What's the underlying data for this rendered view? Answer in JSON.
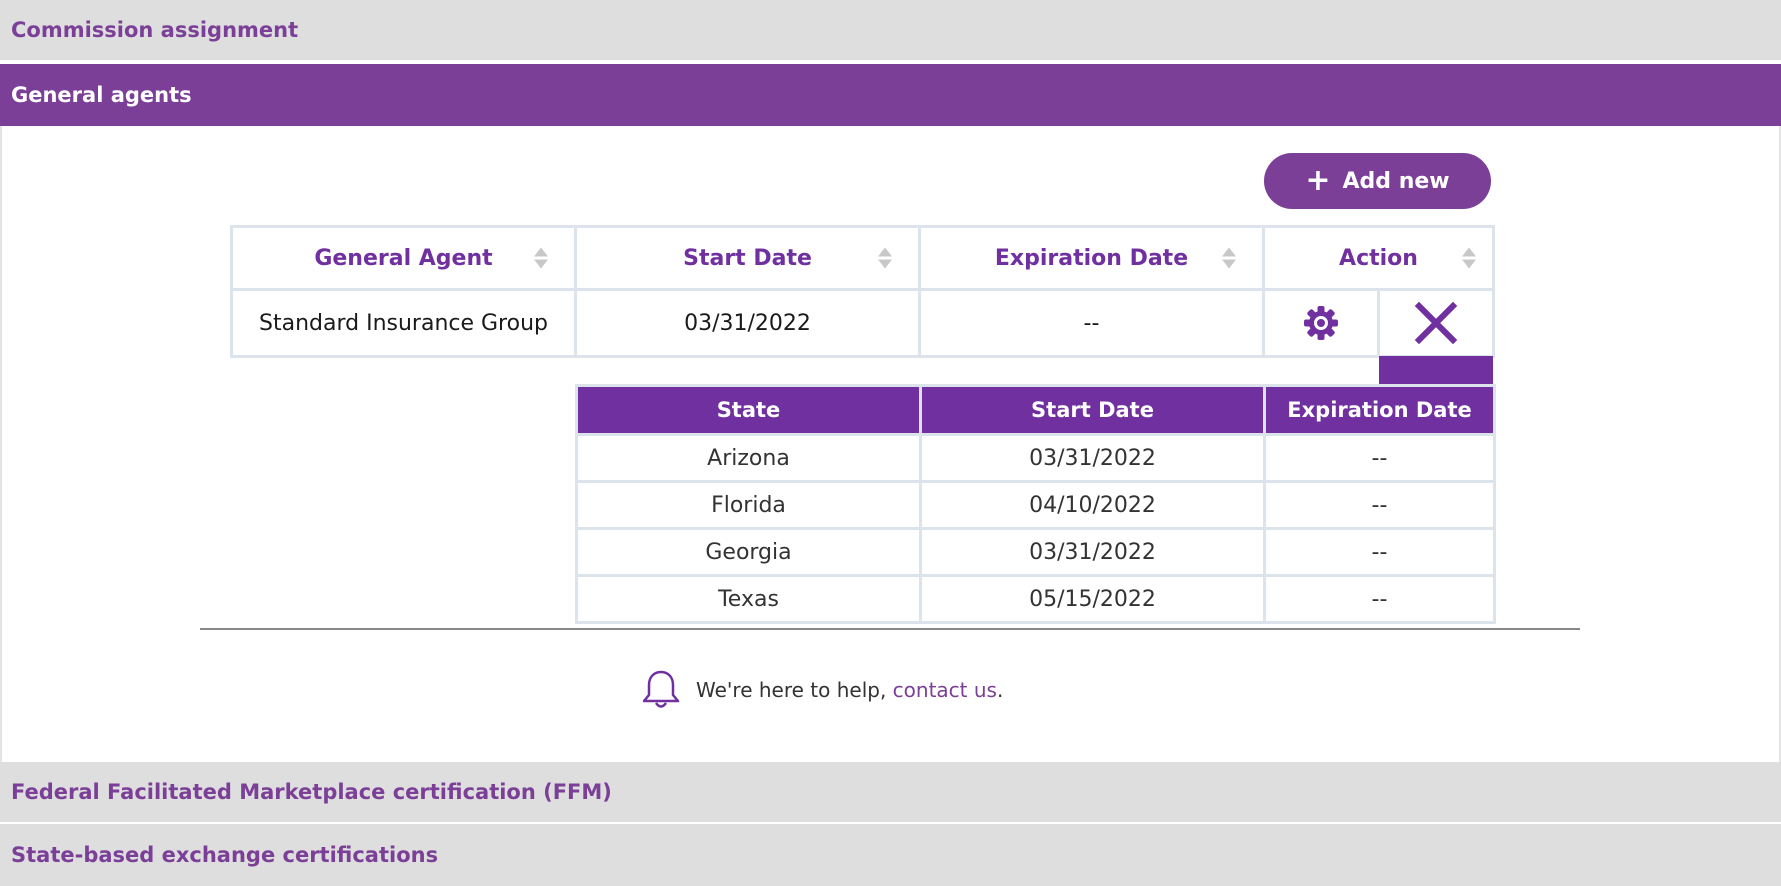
{
  "sections": {
    "commission": "Commission assignment",
    "general_agents": "General agents",
    "ffm": "Federal Facilitated Marketplace certification (FFM)",
    "sbe": "State-based exchange certifications"
  },
  "add_button": {
    "label": "Add new",
    "icon": "plus-icon"
  },
  "agent_table": {
    "columns": [
      "General Agent",
      "Start Date",
      "Expiration Date",
      "Action"
    ],
    "rows": [
      {
        "agent": "Standard Insurance Group",
        "start": "03/31/2022",
        "expiration": "--",
        "actions": [
          "gear-icon",
          "close-icon"
        ]
      }
    ]
  },
  "state_table": {
    "columns": [
      "State",
      "Start Date",
      "Expiration Date"
    ],
    "rows": [
      {
        "state": "Arizona",
        "start": "03/31/2022",
        "expiration": "--"
      },
      {
        "state": "Florida",
        "start": "04/10/2022",
        "expiration": "--"
      },
      {
        "state": "Georgia",
        "start": "03/31/2022",
        "expiration": "--"
      },
      {
        "state": "Texas",
        "start": "05/15/2022",
        "expiration": "--"
      }
    ]
  },
  "help": {
    "text": "We're here to help, ",
    "link": "contact us",
    "suffix": ".",
    "icon": "bell-icon"
  },
  "colors": {
    "brand": "#7b3f98",
    "accent": "#7030a0",
    "collapsed_bg": "#dedede"
  }
}
